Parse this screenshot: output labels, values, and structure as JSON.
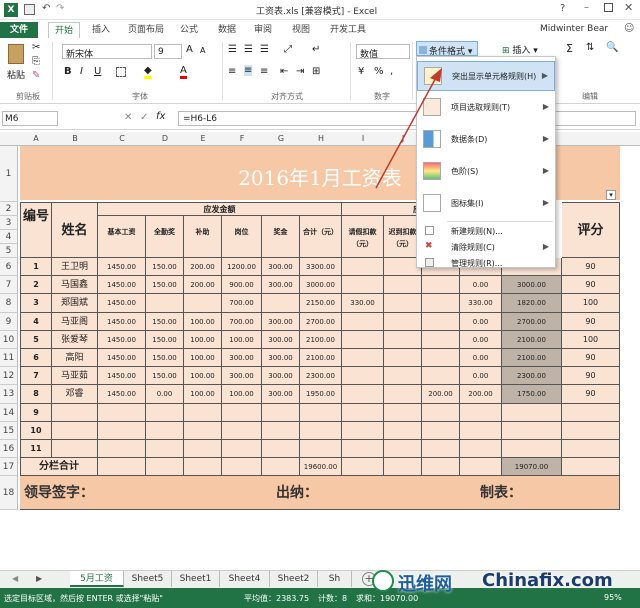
{
  "window": {
    "title": "工资表.xls [兼容模式] - Excel",
    "user": "Midwinter Bear",
    "help": "?"
  },
  "tabs": [
    {
      "label": "文件"
    },
    {
      "label": "开始"
    },
    {
      "label": "插入"
    },
    {
      "label": "页面布局"
    },
    {
      "label": "公式"
    },
    {
      "label": "数据"
    },
    {
      "label": "审阅"
    },
    {
      "label": "视图"
    },
    {
      "label": "开发工具"
    }
  ],
  "ribbon": {
    "clipboard": {
      "paste": "粘贴",
      "label": "剪贴板"
    },
    "font": {
      "name": "新宋体",
      "size": "9",
      "label": "字体"
    },
    "alignment": {
      "label": "对齐方式"
    },
    "number": {
      "format": "数值",
      "label": "数字"
    },
    "styles": {
      "conditional": "条件格式"
    },
    "cells": {
      "insert": "插入"
    },
    "editing": {
      "label": "编辑"
    }
  },
  "formula_bar": {
    "name_box": "M6",
    "fx": "fx",
    "formula": "=H6-L6"
  },
  "columns": [
    "A",
    "B",
    "C",
    "D",
    "E",
    "F",
    "G",
    "H",
    "I",
    "J",
    "K",
    "L",
    "M"
  ],
  "sheet": {
    "title": "2016年1月工资表",
    "h_no": "编号",
    "h_name": "姓名",
    "h_payable": "应发金额",
    "h_deduct": "应",
    "sub": [
      "基本工资",
      "全勤奖",
      "补助",
      "岗位",
      "奖金",
      "合计（元）",
      "请假扣款（元）",
      "迟到扣款（元）"
    ],
    "h_rating": "评分",
    "rows": [
      {
        "r": "6",
        "no": "1",
        "name": "王卫明",
        "c": "1450.00",
        "d": "150.00",
        "e": "200.00",
        "f": "1200.00",
        "g": "300.00",
        "h": "3300.00",
        "i": "",
        "j": "",
        "k": "",
        "l": "",
        "m": "",
        "n": "90"
      },
      {
        "r": "7",
        "no": "2",
        "name": "马国鑫",
        "c": "1450.00",
        "d": "150.00",
        "e": "200.00",
        "f": "900.00",
        "g": "300.00",
        "h": "3000.00",
        "i": "",
        "j": "",
        "k": "",
        "l": "0.00",
        "m": "3000.00",
        "n": "90"
      },
      {
        "r": "8",
        "no": "3",
        "name": "郑国斌",
        "c": "1450.00",
        "d": "",
        "e": "",
        "f": "700.00",
        "g": "",
        "h": "2150.00",
        "i": "330.00",
        "j": "",
        "k": "",
        "l": "330.00",
        "m": "1820.00",
        "n": "100"
      },
      {
        "r": "9",
        "no": "4",
        "name": "马亚阁",
        "c": "1450.00",
        "d": "150.00",
        "e": "100.00",
        "f": "700.00",
        "g": "300.00",
        "h": "2700.00",
        "i": "",
        "j": "",
        "k": "",
        "l": "0.00",
        "m": "2700.00",
        "n": "90"
      },
      {
        "r": "10",
        "no": "5",
        "name": "张爱琴",
        "c": "1450.00",
        "d": "150.00",
        "e": "100.00",
        "f": "100.00",
        "g": "300.00",
        "h": "2100.00",
        "i": "",
        "j": "",
        "k": "",
        "l": "0.00",
        "m": "2100.00",
        "n": "100"
      },
      {
        "r": "11",
        "no": "6",
        "name": "高阳",
        "c": "1450.00",
        "d": "150.00",
        "e": "100.00",
        "f": "300.00",
        "g": "300.00",
        "h": "2100.00",
        "i": "",
        "j": "",
        "k": "",
        "l": "0.00",
        "m": "2100.00",
        "n": "90"
      },
      {
        "r": "12",
        "no": "7",
        "name": "马亚茹",
        "c": "1450.00",
        "d": "150.00",
        "e": "100.00",
        "f": "300.00",
        "g": "300.00",
        "h": "2300.00",
        "i": "",
        "j": "",
        "k": "",
        "l": "0.00",
        "m": "2300.00",
        "n": "90"
      },
      {
        "r": "13",
        "no": "8",
        "name": "邓睿",
        "c": "1450.00",
        "d": "0.00",
        "e": "100.00",
        "f": "100.00",
        "g": "300.00",
        "h": "1950.00",
        "i": "",
        "j": "",
        "k": "200.00",
        "l": "200.00",
        "m": "1750.00",
        "n": "90"
      },
      {
        "r": "14",
        "no": "9",
        "name": "",
        "c": "",
        "d": "",
        "e": "",
        "f": "",
        "g": "",
        "h": "",
        "i": "",
        "j": "",
        "k": "",
        "l": "",
        "m": "",
        "n": ""
      },
      {
        "r": "15",
        "no": "10",
        "name": "",
        "c": "",
        "d": "",
        "e": "",
        "f": "",
        "g": "",
        "h": "",
        "i": "",
        "j": "",
        "k": "",
        "l": "",
        "m": "",
        "n": ""
      },
      {
        "r": "16",
        "no": "11",
        "name": "",
        "c": "",
        "d": "",
        "e": "",
        "f": "",
        "g": "",
        "h": "",
        "i": "",
        "j": "",
        "k": "",
        "l": "",
        "m": "",
        "n": ""
      }
    ],
    "total": {
      "r": "17",
      "label": "分栏合计",
      "h": "19600.00",
      "m": "19070.00"
    },
    "footer": {
      "r": "18",
      "sign": "领导签字：",
      "cashier": "出纳：",
      "maker": "制表："
    }
  },
  "row_labels_extra": [
    "1",
    "2",
    "3",
    "4",
    "5"
  ],
  "menu": {
    "items": [
      {
        "label": "突出显示单元格规则(H)",
        "arrow": "▶"
      },
      {
        "label": "项目选取规则(T)",
        "arrow": "▶"
      },
      {
        "label": "数据条(D)",
        "arrow": "▶"
      },
      {
        "label": "色阶(S)",
        "arrow": "▶"
      },
      {
        "label": "图标集(I)",
        "arrow": "▶"
      }
    ],
    "small": [
      {
        "label": "新建规则(N)..."
      },
      {
        "label": "清除规则(C)",
        "arrow": "▶"
      },
      {
        "label": "管理规则(R)..."
      }
    ]
  },
  "sheet_tabs": [
    "5月工资",
    "Sheet5",
    "Sheet1",
    "Sheet4",
    "Sheet2",
    "Sh"
  ],
  "status": {
    "msg": "选定目标区域，然后按 ENTER 或选择\"粘贴\"",
    "avg": "平均值：2383.75",
    "count": "计数：8",
    "sum": "求和：19070.00",
    "zoom": "95%"
  },
  "watermark": {
    "text1": "迅维网",
    "text2": "Chinafix.com"
  },
  "colors": {
    "excel_green": "#217346",
    "peach": "#fbe3d3",
    "title_bg": "#f6c8a6",
    "total_gray": "#bfb3a8",
    "arrow_red": "#c0392b"
  }
}
